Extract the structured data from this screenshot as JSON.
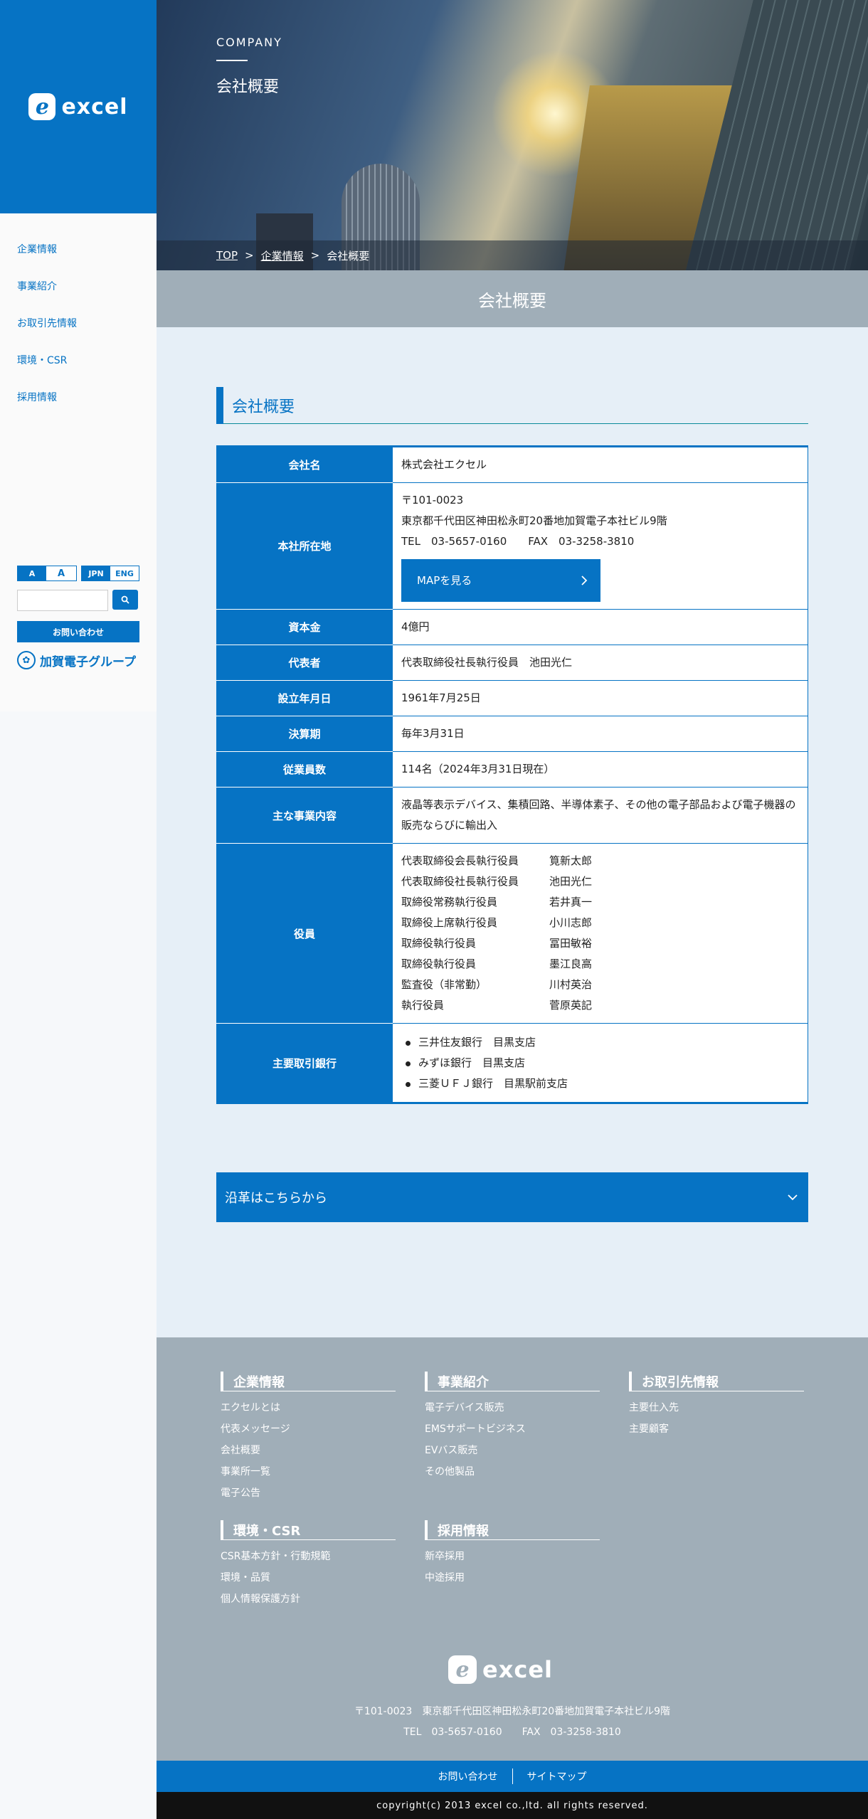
{
  "brand": {
    "logo_mark": "e",
    "logo_word": "excel"
  },
  "sidebar": {
    "nav": [
      {
        "label": "企業情報"
      },
      {
        "label": "事業紹介"
      },
      {
        "label": "お取引先情報"
      },
      {
        "label": "環境・CSR"
      },
      {
        "label": "採用情報"
      }
    ],
    "font_small": "A",
    "font_large": "A",
    "lang_jpn": "JPN",
    "lang_eng": "ENG",
    "search_placeholder": "",
    "contact_label": "お問い合わせ",
    "group_logo_text": "加賀電子グループ"
  },
  "hero": {
    "category": "COMPANY",
    "title": "会社概要"
  },
  "breadcrumb": {
    "top": "TOP",
    "parent": "企業情報",
    "current": "会社概要",
    "sep": ">"
  },
  "page_title": "会社概要",
  "section_title": "会社概要",
  "table": {
    "company_name": {
      "label": "会社名",
      "value": "株式会社エクセル"
    },
    "address": {
      "label": "本社所在地",
      "postal": "〒101-0023",
      "line": "東京都千代田区神田松永町20番地加賀電子本社ビル9階",
      "tel": "TEL　03-5657-0160　　FAX　03-3258-3810",
      "map_button": "MAPを見る"
    },
    "capital": {
      "label": "資本金",
      "value": "4億円"
    },
    "representative": {
      "label": "代表者",
      "value": "代表取締役社長執行役員　池田光仁"
    },
    "founded": {
      "label": "設立年月日",
      "value": "1961年7月25日"
    },
    "fiscal": {
      "label": "決算期",
      "value": "毎年3月31日"
    },
    "employees": {
      "label": "従業員数",
      "value": "114名（2024年3月31日現在）"
    },
    "business": {
      "label": "主な事業内容",
      "value": "液晶等表示デバイス、集積回路、半導体素子、その他の電子部品および電子機器の販売ならびに輸出入"
    },
    "officers": {
      "label": "役員",
      "rows": [
        {
          "role": "代表取締役会長執行役員",
          "name": "筧新太郎"
        },
        {
          "role": "代表取締役社長執行役員",
          "name": "池田光仁"
        },
        {
          "role": "取締役常務執行役員",
          "name": "若井真一"
        },
        {
          "role": "取締役上席執行役員",
          "name": "小川志郎"
        },
        {
          "role": "取締役執行役員",
          "name": "冨田敏裕"
        },
        {
          "role": "取締役執行役員",
          "name": "墨江良高"
        },
        {
          "role": "監査役（非常勤）",
          "name": "川村英治"
        },
        {
          "role": "執行役員",
          "name": "菅原英記"
        }
      ]
    },
    "banks": {
      "label": "主要取引銀行",
      "items": [
        "三井住友銀行　目黒支店",
        "みずほ銀行　目黒支店",
        "三菱ＵＦＪ銀行　目黒駅前支店"
      ]
    }
  },
  "history_label": "沿革はこちらから",
  "footer": {
    "cols": [
      {
        "title": "企業情報",
        "links": [
          "エクセルとは",
          "代表メッセージ",
          "会社概要",
          "事業所一覧",
          "電子公告"
        ]
      },
      {
        "title": "事業紹介",
        "links": [
          "電子デバイス販売",
          "EMSサポートビジネス",
          "EVバス販売",
          "その他製品"
        ]
      },
      {
        "title": "お取引先情報",
        "links": [
          "主要仕入先",
          "主要顧客"
        ]
      },
      {
        "title": "環境・CSR",
        "links": [
          "CSR基本方針・行動規範",
          "環境・品質",
          "個人情報保護方針"
        ]
      },
      {
        "title": "採用情報",
        "links": [
          "新卒採用",
          "中途採用"
        ]
      }
    ],
    "address": "〒101-0023　東京都千代田区神田松永町20番地加賀電子本社ビル9階",
    "tel": "TEL　03-5657-0160　　FAX　03-3258-3810",
    "nav_contact": "お問い合わせ",
    "nav_sitemap": "サイトマップ",
    "copyright": "copyright(c) 2013 excel co.,ltd. all rights reserved."
  },
  "colors": {
    "brand_blue": "#0673c4",
    "gray": "#a0aeb8"
  }
}
